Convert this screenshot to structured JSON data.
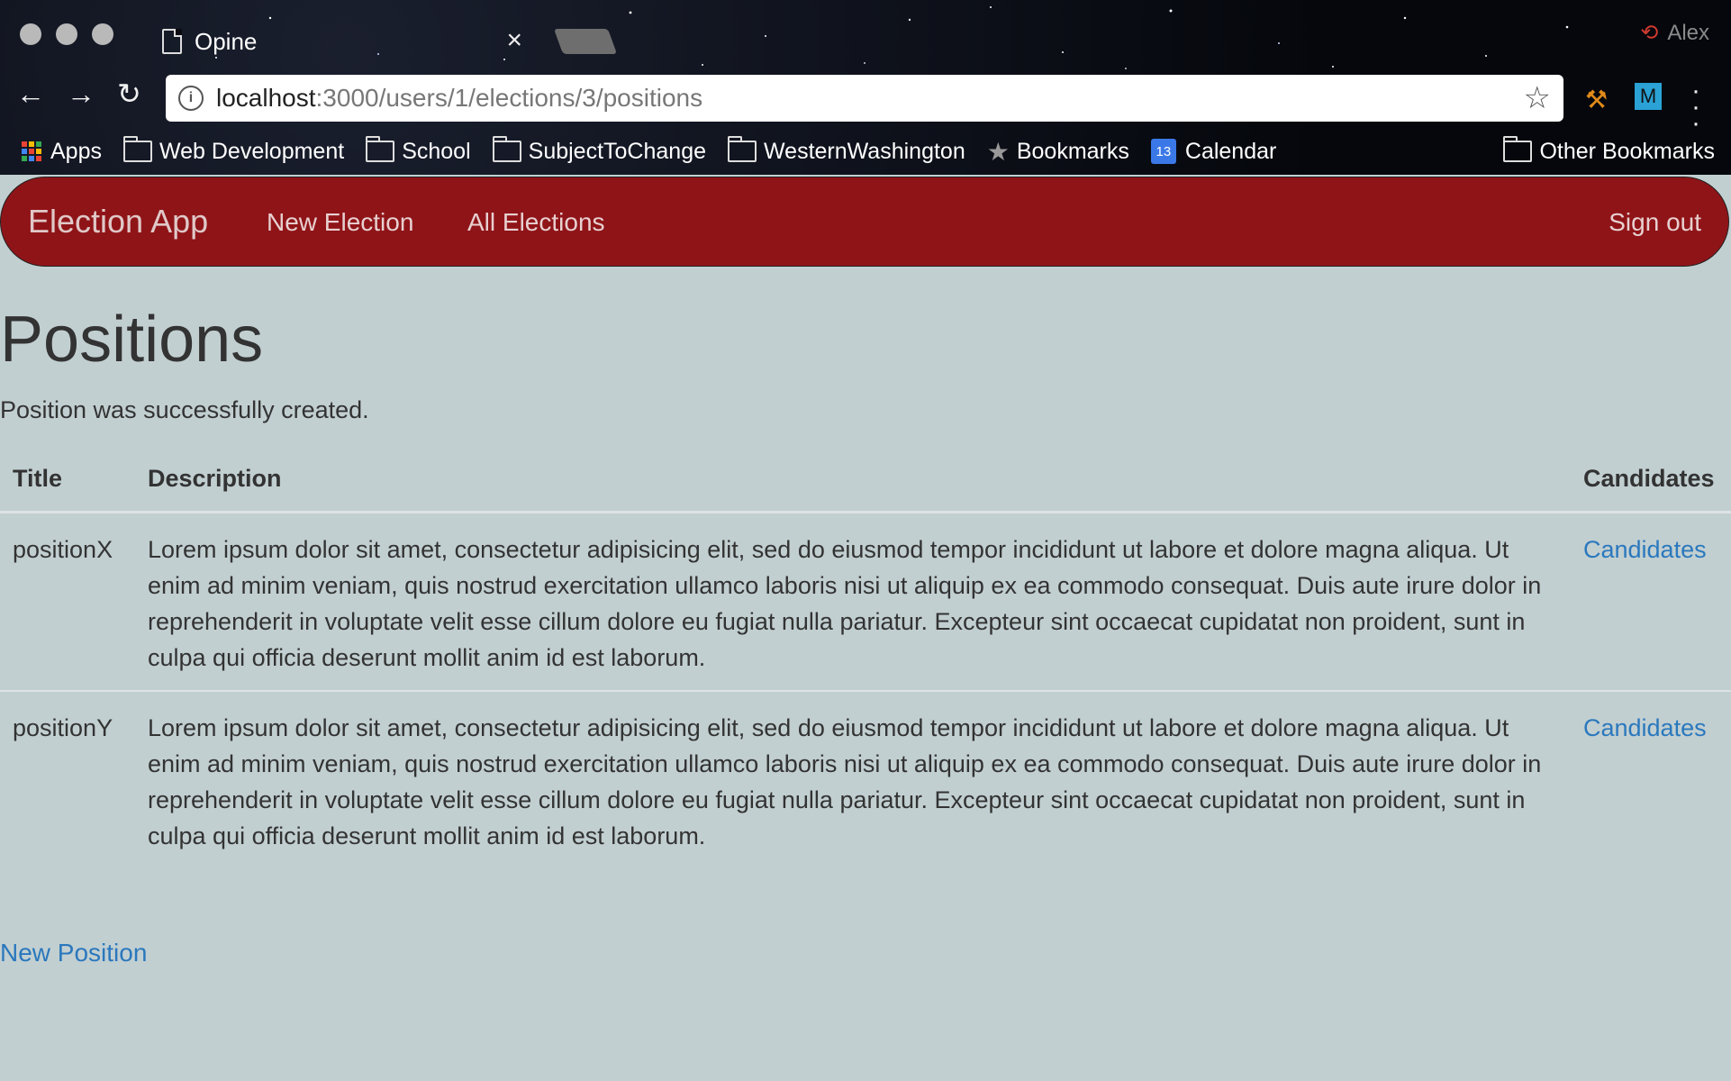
{
  "browser": {
    "tab_title": "Opine",
    "tab_close": "×",
    "profile_name": "Alex",
    "url_host": "localhost",
    "url_path": ":3000/users/1/elections/3/positions",
    "bookmarks": [
      {
        "label": "Apps",
        "icon": "apps-grid-icon"
      },
      {
        "label": "Web Development",
        "icon": "folder-icon"
      },
      {
        "label": "School",
        "icon": "folder-icon"
      },
      {
        "label": "SubjectToChange",
        "icon": "folder-icon"
      },
      {
        "label": "WesternWashington",
        "icon": "folder-icon"
      },
      {
        "label": "Bookmarks",
        "icon": "star-icon"
      },
      {
        "label": "Calendar",
        "icon": "calendar-icon",
        "icon_text": "13"
      }
    ],
    "other_bookmarks": "Other Bookmarks",
    "extension_label": "M"
  },
  "navbar": {
    "brand": "Election App",
    "new_election": "New Election",
    "all_elections": "All Elections",
    "sign_out": "Sign out",
    "color": "#8f1418"
  },
  "page": {
    "title": "Positions",
    "notice": "Position was successfully created.",
    "new_position_link": "New Position"
  },
  "table": {
    "headers": {
      "title": "Title",
      "description": "Description",
      "candidates": "Candidates"
    },
    "rows": [
      {
        "title": "positionX",
        "description": "Lorem ipsum dolor sit amet, consectetur adipisicing elit, sed do eiusmod tempor incididunt ut labore et dolore magna aliqua. Ut enim ad minim veniam, quis nostrud exercitation ullamco laboris nisi ut aliquip ex ea commodo consequat. Duis aute irure dolor in reprehenderit in voluptate velit esse cillum dolore eu fugiat nulla pariatur. Excepteur sint occaecat cupidatat non proident, sunt in culpa qui officia deserunt mollit anim id est laborum.",
        "candidates_link": "Candidates"
      },
      {
        "title": "positionY",
        "description": "Lorem ipsum dolor sit amet, consectetur adipisicing elit, sed do eiusmod tempor incididunt ut labore et dolore magna aliqua. Ut enim ad minim veniam, quis nostrud exercitation ullamco laboris nisi ut aliquip ex ea commodo consequat. Duis aute irure dolor in reprehenderit in voluptate velit esse cillum dolore eu fugiat nulla pariatur. Excepteur sint occaecat cupidatat non proident, sunt in culpa qui officia deserunt mollit anim id est laborum.",
        "candidates_link": "Candidates"
      }
    ]
  }
}
